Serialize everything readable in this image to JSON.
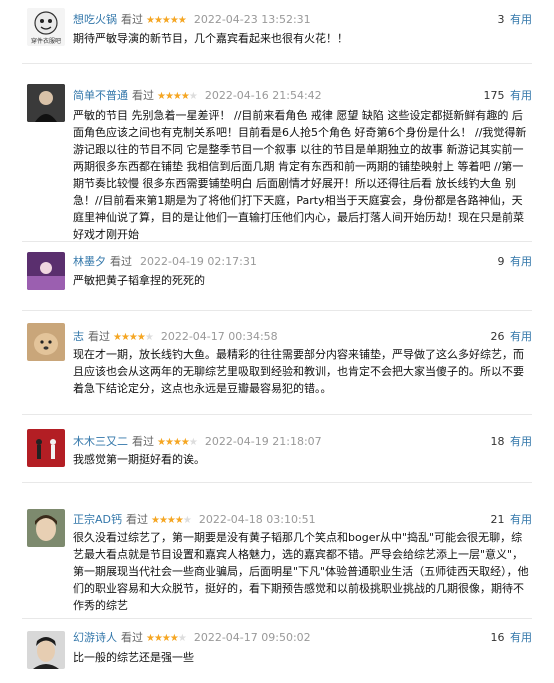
{
  "comments": [
    {
      "author": "想吃火锅",
      "seen": "看过",
      "rating": 5,
      "time": "2022-04-23 13:52:31",
      "votes": "3",
      "useful": "有用",
      "avatar_caption": "穿件衣服吧",
      "text": "期待严敏导演的新节目，几个嘉宾看起来也很有火花！！"
    },
    {
      "author": "简单不普通",
      "seen": "看过",
      "rating": 4,
      "time": "2022-04-16 21:54:42",
      "votes": "175",
      "useful": "有用",
      "text": "严敏的节目 先别急着一星差评！ //目前来看角色 戒律 愿望 缺陷 这些设定都挺新鲜有趣的 后面角色应该之间也有克制关系吧！目前看是6人抢5个角色 好奇第6个身份是什么！ //我觉得新游记跟以往的节目不同 它是整季节目一个叙事 以往的节目是单期独立的故事 新游记其实前一两期很多东西都在铺垫 我相信到后面几期 肯定有东西和前一两期的铺垫映射上 等着吧 //第一期节奏比较慢 很多东西需要铺垫明白 后面剧情才好展开！所以还得往后看 放长线钓大鱼 别急！//目前看来第1期是为了将他们打下天庭，Party相当于天庭宴会，身份都是各路神仙，天庭里神仙说了算，目的是让他们一直输打压他们内心，最后打落人间开始历劫！现在只是前菜 好戏才刚开始"
    },
    {
      "author": "林墨夕",
      "seen": "看过",
      "rating": 0,
      "time": "2022-04-19 02:17:31",
      "votes": "9",
      "useful": "有用",
      "text": "严敏把黄子韬拿捏的死死的"
    },
    {
      "author": "志",
      "seen": "看过",
      "rating": 4,
      "time": "2022-04-17 00:34:58",
      "votes": "26",
      "useful": "有用",
      "text": "现在才一期，放长线钓大鱼。最精彩的往往需要部分内容来铺垫，严导做了这么多好综艺，而且应该也会从这两年的无聊综艺里吸取到经验和教训，也肯定不会把大家当傻子的。所以不要着急下结论定分，这点也永远是豆瓣最容易犯的错。。"
    },
    {
      "author": "木木三又二",
      "seen": "看过",
      "rating": 4,
      "time": "2022-04-19 21:18:07",
      "votes": "18",
      "useful": "有用",
      "text": "我感觉第一期挺好看的诶。"
    },
    {
      "author": "正宗AD钙",
      "seen": "看过",
      "rating": 4,
      "time": "2022-04-18 03:10:51",
      "votes": "21",
      "useful": "有用",
      "text": "很久没看过综艺了，第一期要是没有黄子韬那几个笑点和boger从中\"捣乱\"可能会很无聊，综艺最大看点就是节目设置和嘉宾人格魅力，选的嘉宾都不错。严导会给综艺添上一层\"意义\"，第一期展现当代社会一些商业骗局，后面明星\"下凡\"体验普通职业生活（五师徒西天取经），他们的职业容易和大众脱节，挺好的，看下期预告感觉和以前极挑职业挑战的几期很像，期待不作秀的综艺"
    },
    {
      "author": "幻游诗人",
      "seen": "看过",
      "rating": 4,
      "time": "2022-04-17 09:50:02",
      "votes": "16",
      "useful": "有用",
      "text": "比一般的综艺还是强一些"
    }
  ]
}
